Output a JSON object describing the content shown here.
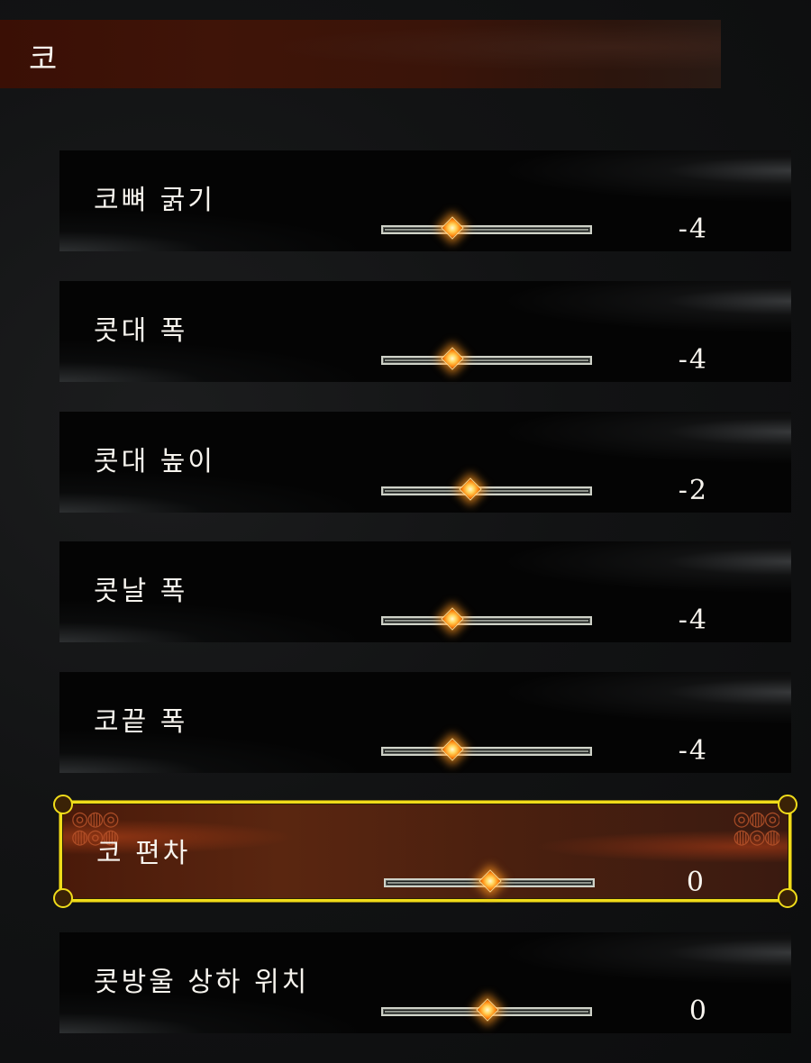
{
  "header": {
    "title": "코"
  },
  "slider_min": -10,
  "slider_max": 10,
  "rows": [
    {
      "label": "코뼈 굵기",
      "value": -4,
      "selected": false
    },
    {
      "label": "콧대 폭",
      "value": -4,
      "selected": false
    },
    {
      "label": "콧대 높이",
      "value": -2,
      "selected": false
    },
    {
      "label": "콧날 폭",
      "value": -4,
      "selected": false
    },
    {
      "label": "코끝 폭",
      "value": -4,
      "selected": false
    },
    {
      "label": "코 편차",
      "value": 0,
      "selected": true
    },
    {
      "label": "콧방울 상하 위치",
      "value": 0,
      "selected": false
    }
  ],
  "colors": {
    "selected_border": "#f0dc1a",
    "thumb_glow": "#ff8a10",
    "header_bg": "#3a0f05"
  }
}
